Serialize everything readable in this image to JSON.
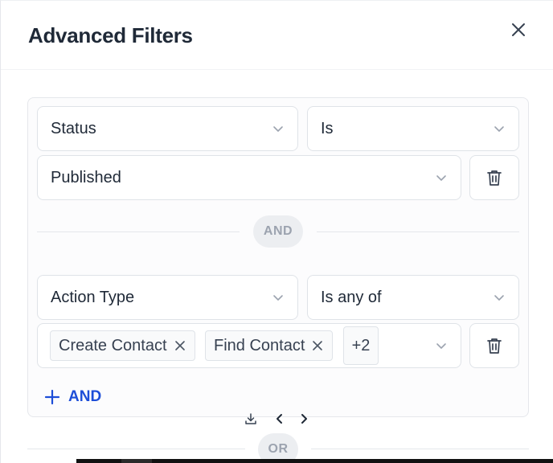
{
  "modal": {
    "title": "Advanced Filters"
  },
  "groups": [
    {
      "rows": [
        {
          "field": "Status",
          "operator": "Is",
          "value": "Published"
        }
      ]
    },
    {
      "rows": [
        {
          "field": "Action Type",
          "operator": "Is any of",
          "tags": [
            "Create Contact",
            "Find Contact"
          ],
          "more_count": "+2"
        }
      ]
    }
  ],
  "connectors": {
    "and_label": "AND",
    "or_label": "OR"
  },
  "actions": {
    "add_and_label": "AND"
  },
  "colors": {
    "accent": "#1d4ed8",
    "border": "#dfe3e8",
    "pill_bg": "#eceef1"
  },
  "icons": [
    "close-icon",
    "chevron-down-icon",
    "trash-icon",
    "plus-icon",
    "download-icon",
    "chevron-left-icon",
    "chevron-right-icon"
  ]
}
